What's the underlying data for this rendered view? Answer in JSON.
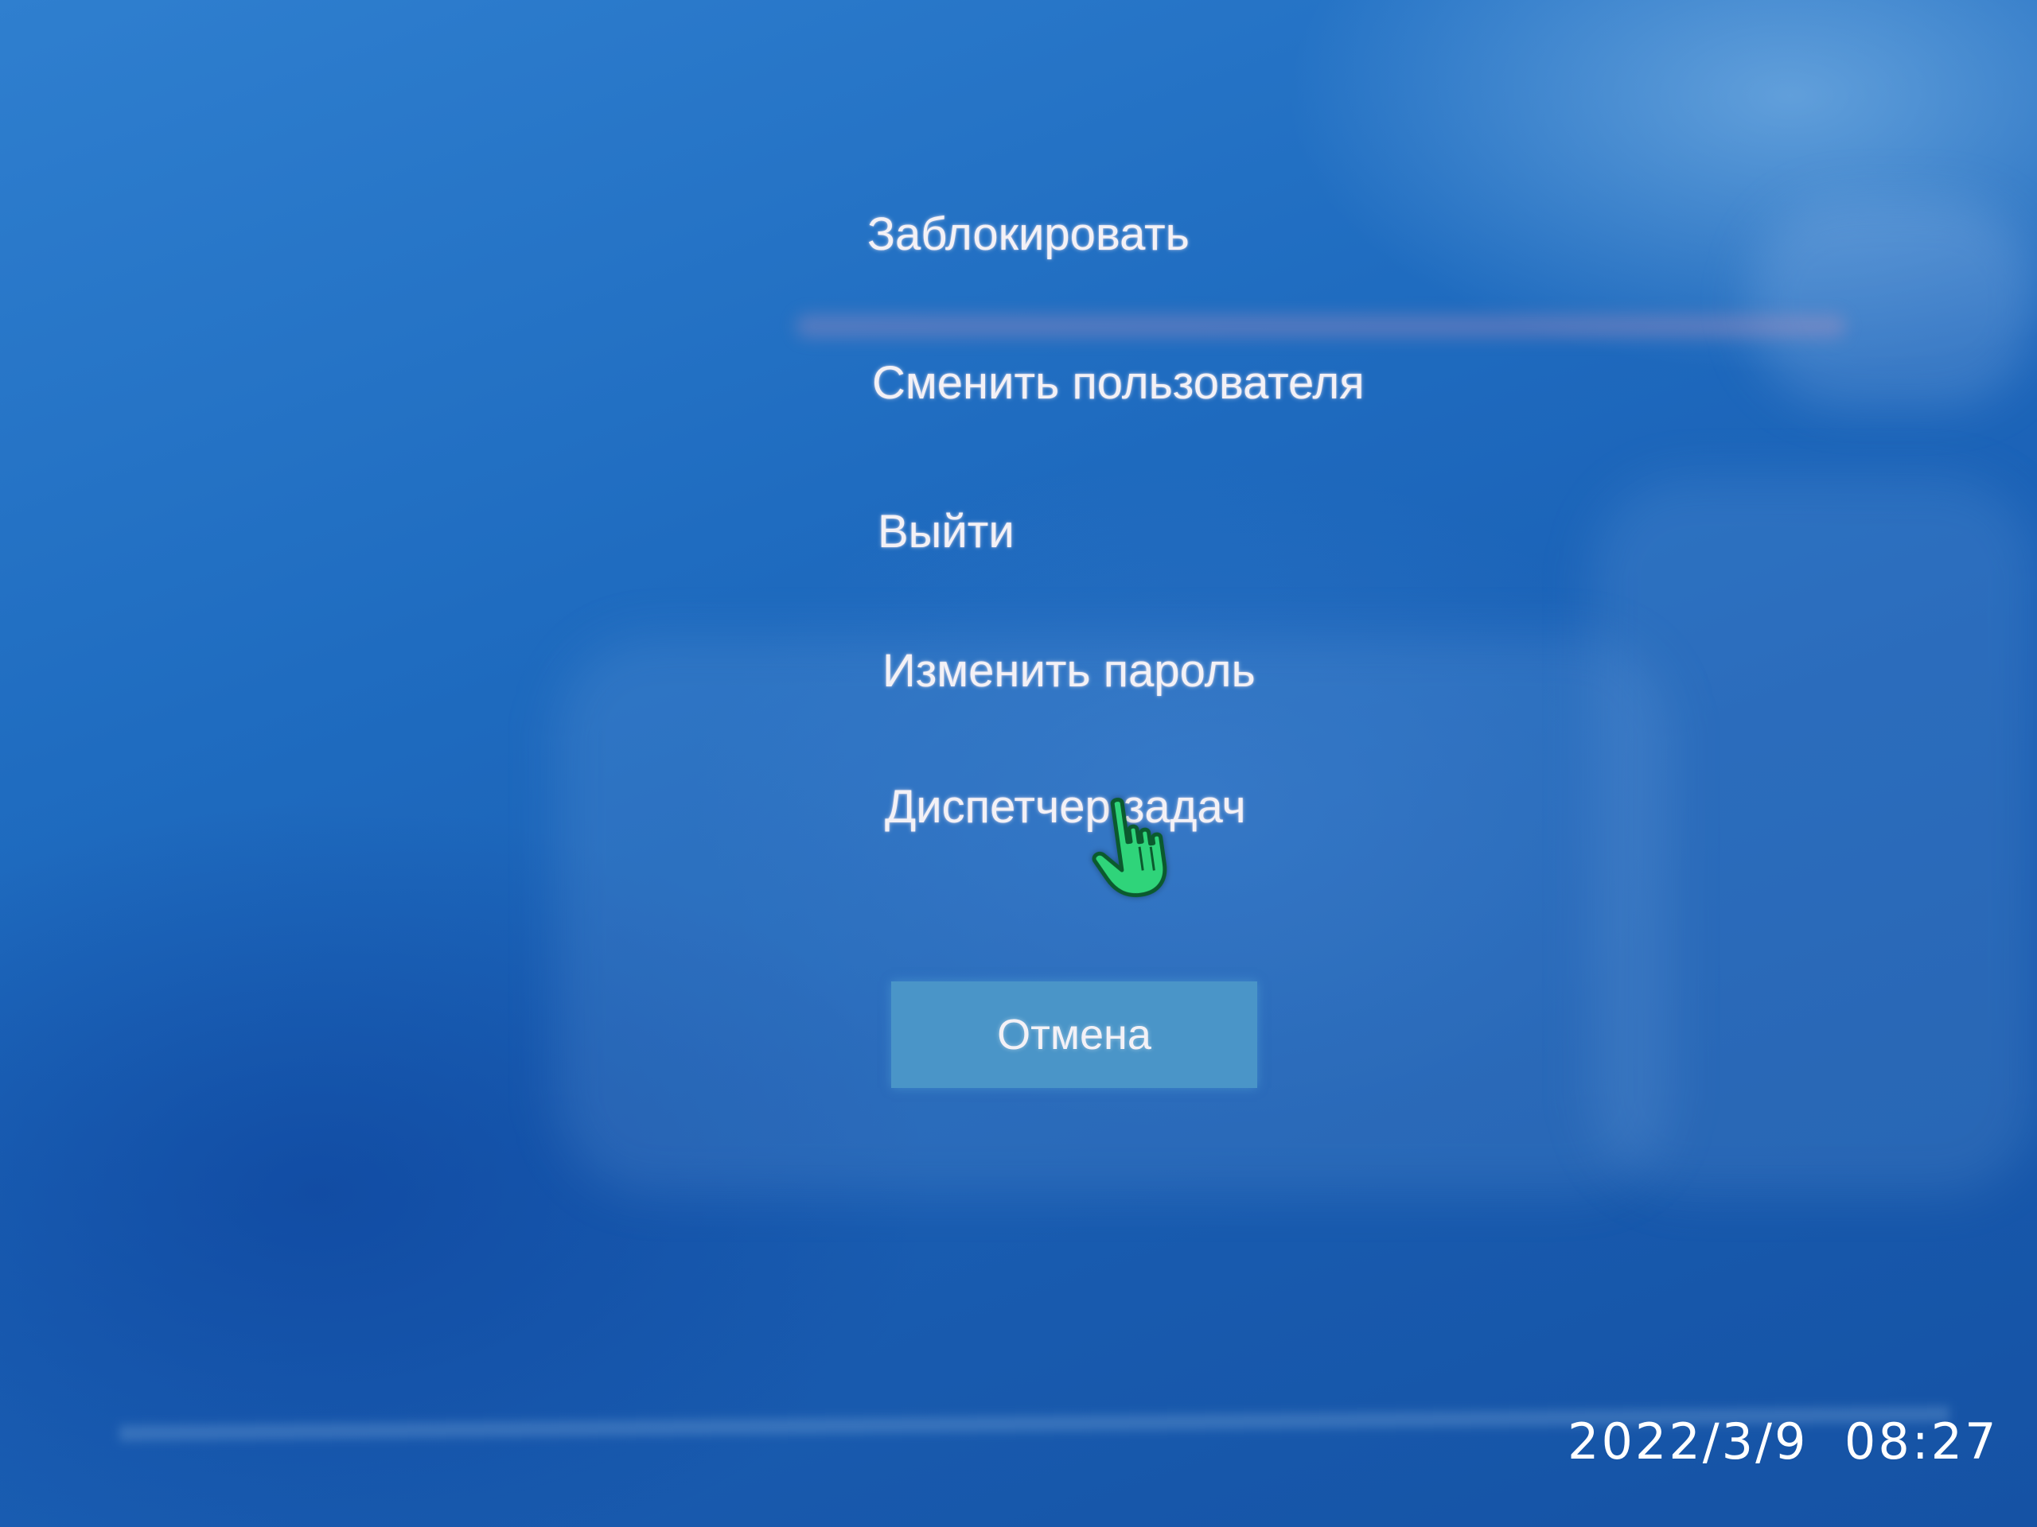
{
  "security_menu": {
    "options": [
      {
        "id": "lock",
        "label": "Заблокировать"
      },
      {
        "id": "switch_user",
        "label": "Сменить пользователя"
      },
      {
        "id": "sign_out",
        "label": "Выйти"
      },
      {
        "id": "change_password",
        "label": "Изменить пароль"
      },
      {
        "id": "task_manager",
        "label": "Диспетчер задач"
      }
    ],
    "cancel_label": "Отмена"
  },
  "cursor": {
    "icon": "hand-pointer-icon",
    "color": "#2fd47a"
  },
  "camera_timestamp": {
    "date": "2022/3/9",
    "time": "08:27"
  },
  "colors": {
    "background": "#1a5fb4",
    "text": "#f3f1f6",
    "cancel_button": "#4a95c8"
  }
}
